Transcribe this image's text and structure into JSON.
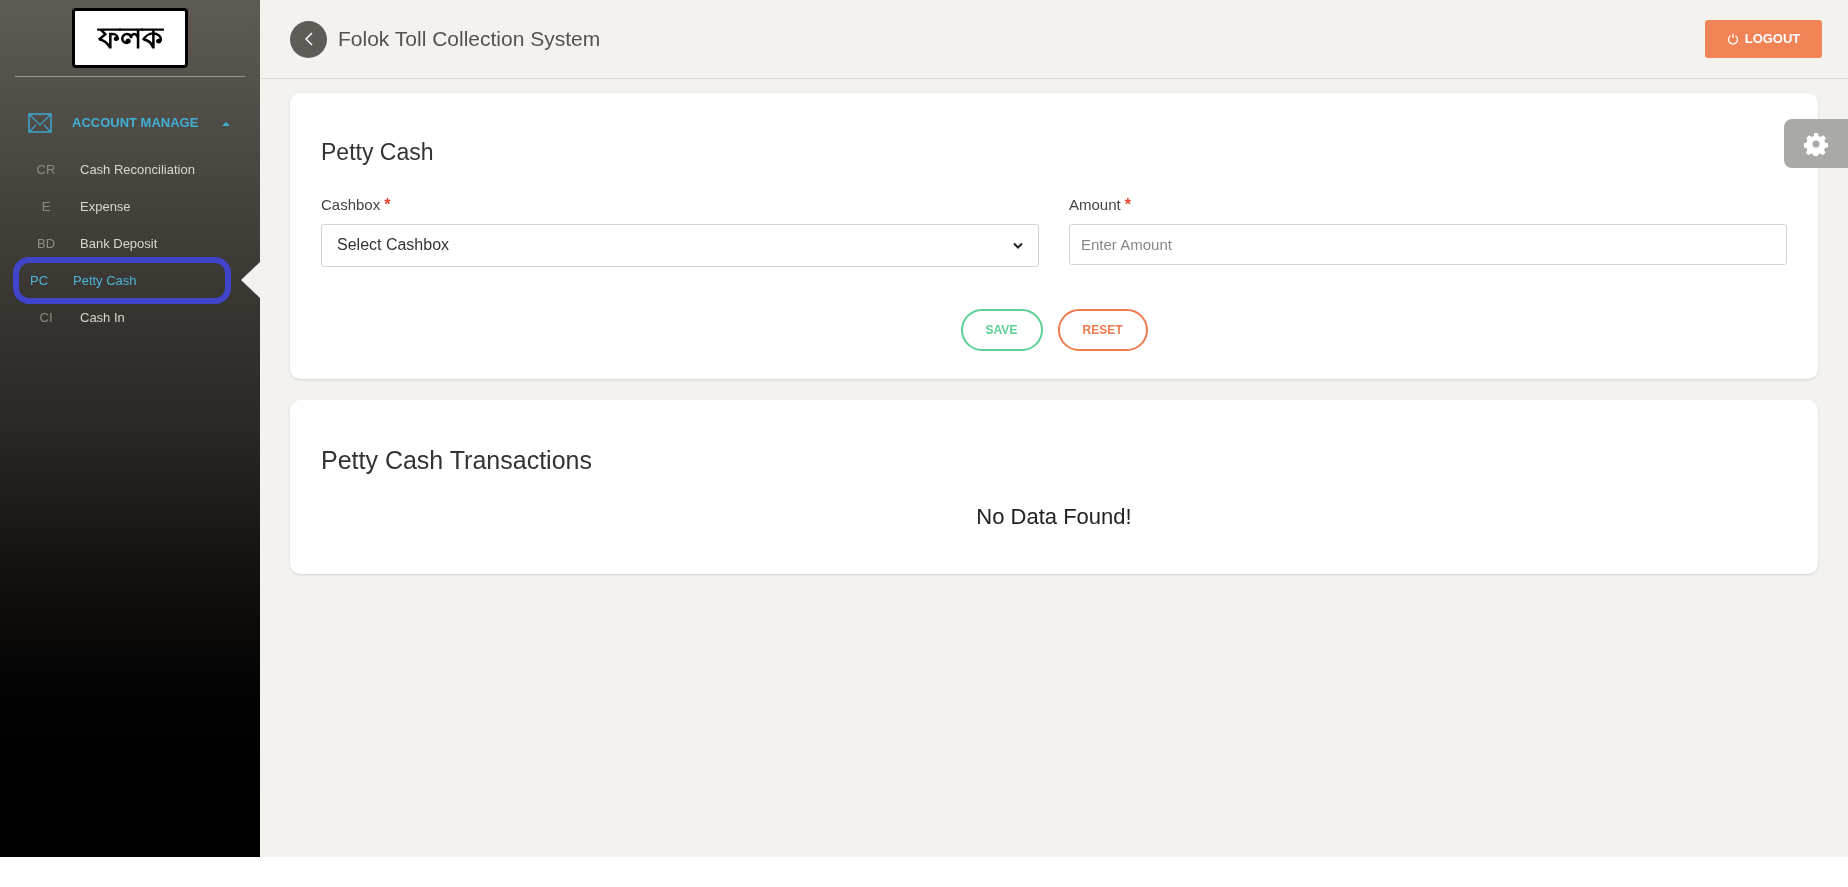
{
  "logo": {
    "text": "ফলক"
  },
  "sidebar": {
    "group": {
      "label": "ACCOUNT MANAGE",
      "expanded": true
    },
    "items": [
      {
        "abbr": "CR",
        "label": "Cash Reconciliation",
        "selected": false
      },
      {
        "abbr": "E",
        "label": "Expense",
        "selected": false
      },
      {
        "abbr": "BD",
        "label": "Bank Deposit",
        "selected": false
      },
      {
        "abbr": "PC",
        "label": "Petty Cash",
        "selected": true
      },
      {
        "abbr": "CI",
        "label": "Cash In",
        "selected": false
      }
    ]
  },
  "header": {
    "title": "Folok Toll Collection System",
    "logout": "LOGOUT"
  },
  "form": {
    "title": "Petty Cash",
    "fields": [
      {
        "kind": "select",
        "label": "Cashbox",
        "required_mark": "*",
        "value": "Select Cashbox"
      },
      {
        "kind": "input",
        "label": "Amount",
        "required_mark": "*",
        "placeholder": "Enter Amount"
      }
    ],
    "buttons": [
      {
        "kind": "save",
        "label": "SAVE"
      },
      {
        "kind": "reset",
        "label": "RESET"
      }
    ]
  },
  "transactions": {
    "title": "Petty Cash Transactions",
    "empty_message": "No Data Found!"
  }
}
